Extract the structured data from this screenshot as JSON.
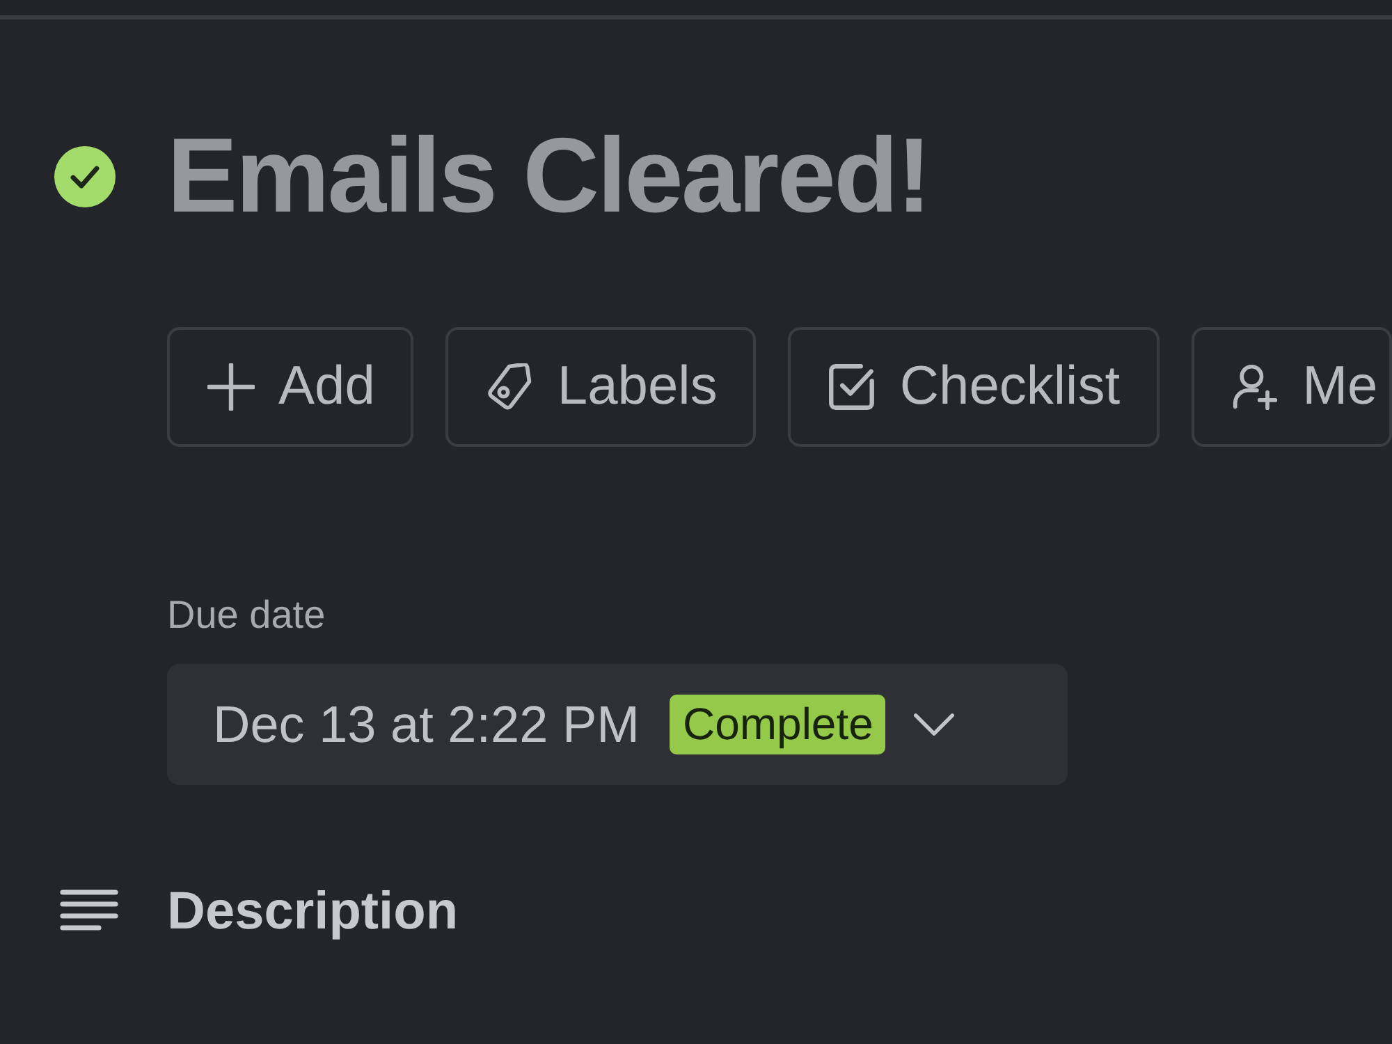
{
  "task": {
    "title": "Emails Cleared!",
    "completed": true
  },
  "actions": [
    {
      "label": "Add",
      "kind": "plus"
    },
    {
      "label": "Labels",
      "kind": "tag"
    },
    {
      "label": "Checklist",
      "kind": "checklist"
    },
    {
      "label": "Me",
      "kind": "member"
    }
  ],
  "due_date": {
    "label": "Due date",
    "value": "Dec 13 at 2:22 PM",
    "status": "Complete",
    "completed": true
  },
  "description": {
    "heading": "Description"
  }
}
